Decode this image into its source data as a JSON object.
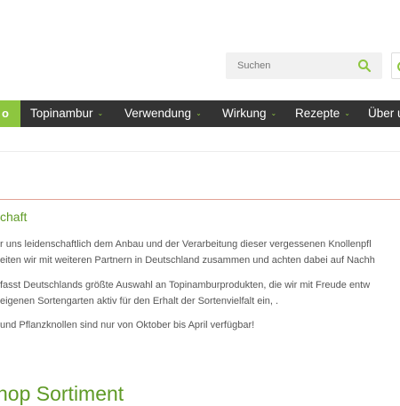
{
  "search": {
    "placeholder": "Suchen"
  },
  "nav": {
    "home_label": "o",
    "items": [
      {
        "label": "Topinambur"
      },
      {
        "label": "Verwendung"
      },
      {
        "label": "Wirkung"
      },
      {
        "label": "Rezepte"
      },
      {
        "label": "Über u"
      }
    ],
    "caret": "⌄"
  },
  "content": {
    "heading": "chaft",
    "paragraph1": [
      "r uns leidenschaftlich dem Anbau und der Verarbeitung dieser vergessenen Knollenpfl",
      "eiten wir mit weiteren Partnern in Deutschland zusammen und achten dabei auf Nachh"
    ],
    "paragraph2": [
      "fasst Deutschlands größte Auswahl an Topinamburprodukten, die wir mit Freude entw",
      "eigenen Sortengarten aktiv für den Erhalt der Sortenvielfalt ein, ."
    ],
    "paragraph3": " und Pflanzknollen sind nur von Oktober bis April verfügbar!",
    "sortiment_heading": "hop Sortiment"
  },
  "colors": {
    "accent_green": "#8dc63f",
    "heading_green": "#5f9a26",
    "nav_bg": "#333333",
    "divider_red": "#e2a395"
  }
}
